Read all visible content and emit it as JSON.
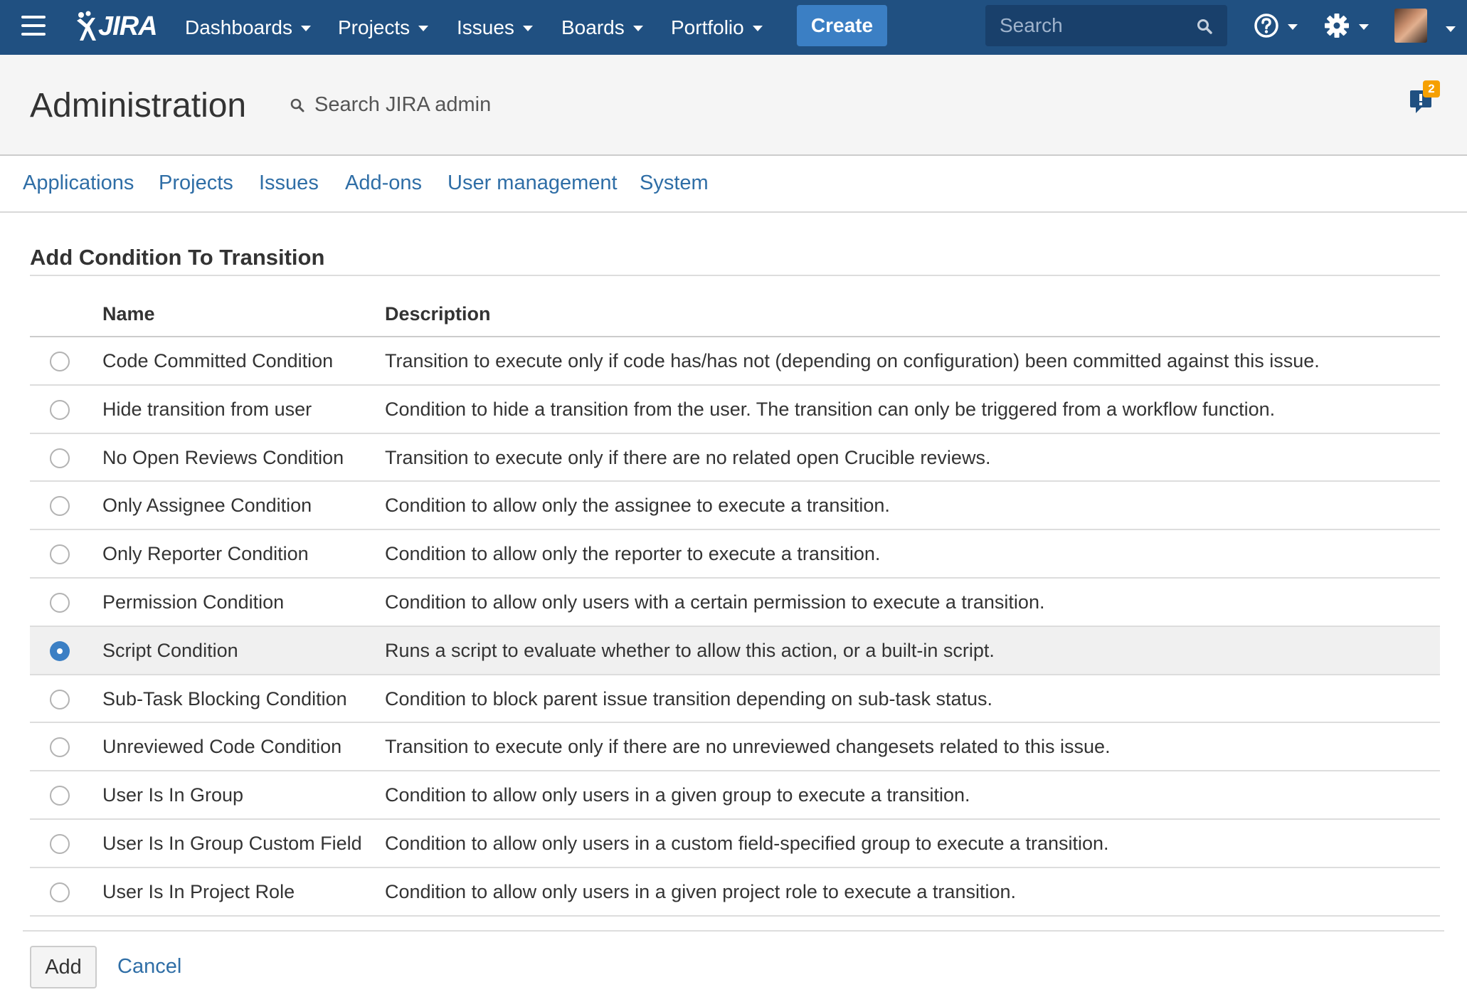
{
  "topnav": {
    "logo_text": "JIRA",
    "menus": [
      {
        "label": "Dashboards"
      },
      {
        "label": "Projects"
      },
      {
        "label": "Issues"
      },
      {
        "label": "Boards"
      },
      {
        "label": "Portfolio"
      }
    ],
    "create_label": "Create",
    "search_placeholder": "Search",
    "brand_color": "#205081",
    "create_color": "#3b7fc4"
  },
  "admin": {
    "title": "Administration",
    "search_label": "Search JIRA admin",
    "notification_count": "2",
    "tabs": [
      {
        "label": "Applications"
      },
      {
        "label": "Projects"
      },
      {
        "label": "Issues"
      },
      {
        "label": "Add-ons"
      },
      {
        "label": "User management"
      },
      {
        "label": "System"
      }
    ]
  },
  "content": {
    "title": "Add Condition To Transition",
    "columns": {
      "name": "Name",
      "description": "Description"
    },
    "rows": [
      {
        "name": "Code Committed Condition",
        "description": "Transition to execute only if code has/has not (depending on configuration) been committed against this issue.",
        "selected": false
      },
      {
        "name": "Hide transition from user",
        "description": "Condition to hide a transition from the user. The transition can only be triggered from a workflow function.",
        "selected": false
      },
      {
        "name": "No Open Reviews Condition",
        "description": "Transition to execute only if there are no related open Crucible reviews.",
        "selected": false
      },
      {
        "name": "Only Assignee Condition",
        "description": "Condition to allow only the assignee to execute a transition.",
        "selected": false
      },
      {
        "name": "Only Reporter Condition",
        "description": "Condition to allow only the reporter to execute a transition.",
        "selected": false
      },
      {
        "name": "Permission Condition",
        "description": "Condition to allow only users with a certain permission to execute a transition.",
        "selected": false
      },
      {
        "name": "Script Condition",
        "description": "Runs a script to evaluate whether to allow this action, or a built-in script.",
        "selected": true
      },
      {
        "name": "Sub-Task Blocking Condition",
        "description": "Condition to block parent issue transition depending on sub-task status.",
        "selected": false
      },
      {
        "name": "Unreviewed Code Condition",
        "description": "Transition to execute only if there are no unreviewed changesets related to this issue.",
        "selected": false
      },
      {
        "name": "User Is In Group",
        "description": "Condition to allow only users in a given group to execute a transition.",
        "selected": false
      },
      {
        "name": "User Is In Group Custom Field",
        "description": "Condition to allow only users in a custom field-specified group to execute a transition.",
        "selected": false
      },
      {
        "name": "User Is In Project Role",
        "description": "Condition to allow only users in a given project role to execute a transition.",
        "selected": false
      }
    ],
    "add_label": "Add",
    "cancel_label": "Cancel"
  }
}
